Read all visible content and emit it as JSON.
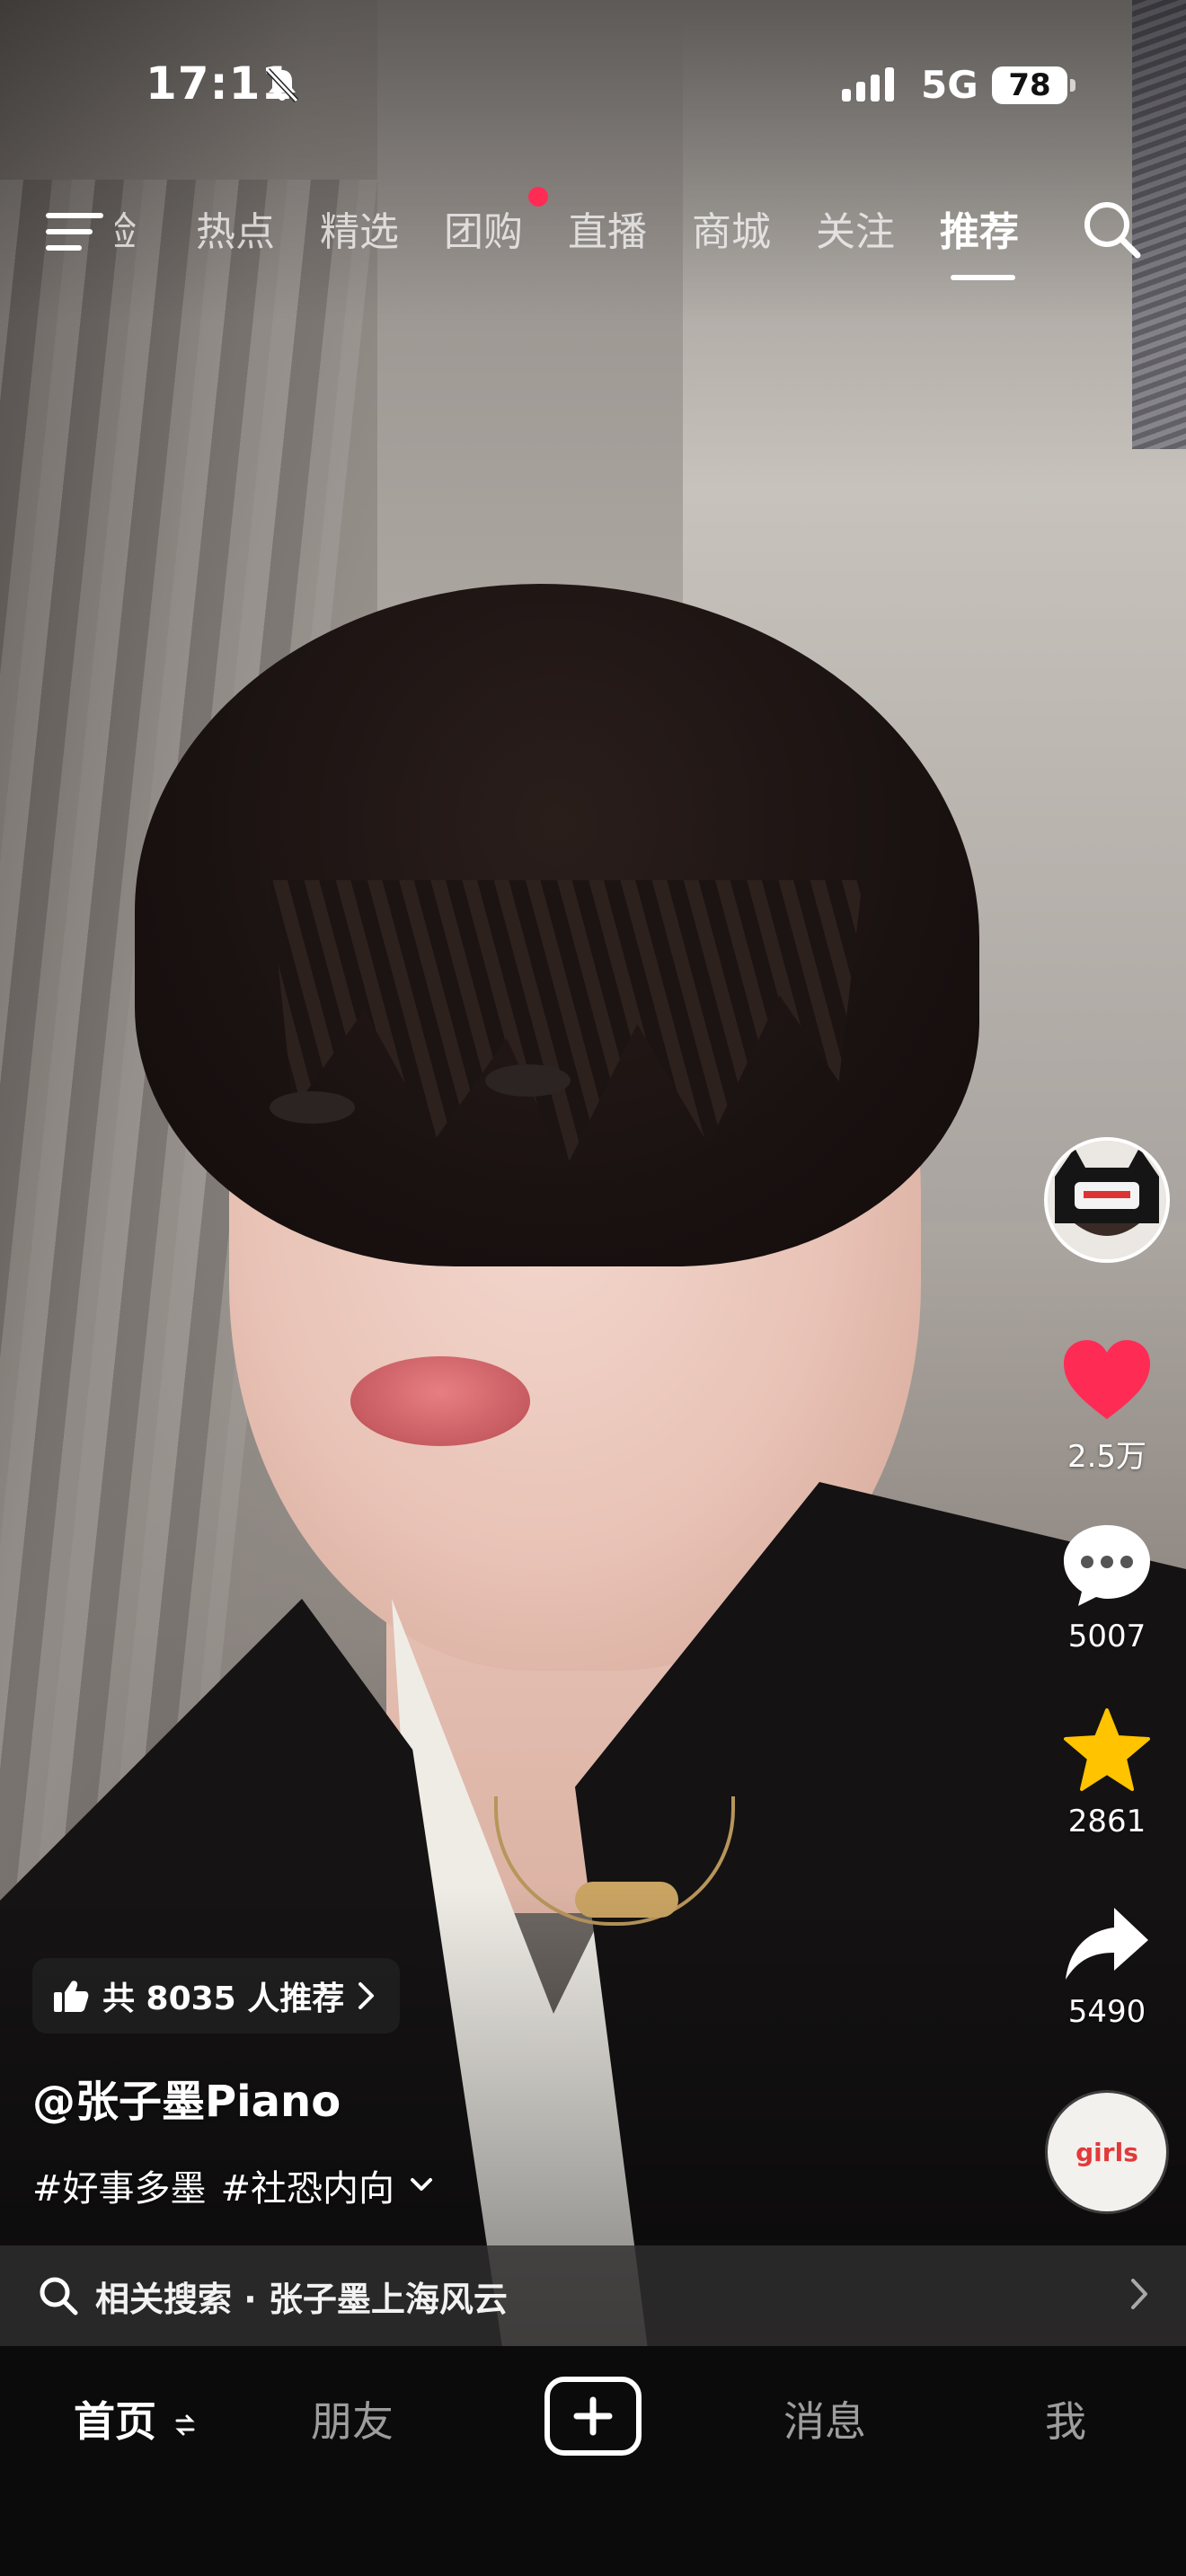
{
  "status_bar": {
    "time": "17:11",
    "network": "5G",
    "battery": "78"
  },
  "top_nav": {
    "cut_tab": "验",
    "tabs": [
      "热点",
      "精选",
      "团购",
      "直播",
      "商城",
      "关注",
      "推荐"
    ],
    "active_tab": "推荐",
    "badge_tab": "团购",
    "accent_color": "#fe2c55"
  },
  "video": {
    "recommend_text": "共 8035 人推荐",
    "author": "@张子墨Piano",
    "hashtags": [
      "#好事多墨",
      "#社恐内向"
    ]
  },
  "actions": {
    "likes": "2.5万",
    "comments": "5007",
    "favorites": "2861",
    "shares": "5490",
    "like_color": "#fe2c55",
    "favorite_color": "#ffc300"
  },
  "music": {
    "disc_text": "girls"
  },
  "related_search": {
    "label": "相关搜索 · 张子墨上海风云"
  },
  "bottom_nav": {
    "home": "首页",
    "friends": "朋友",
    "messages": "消息",
    "me": "我"
  }
}
